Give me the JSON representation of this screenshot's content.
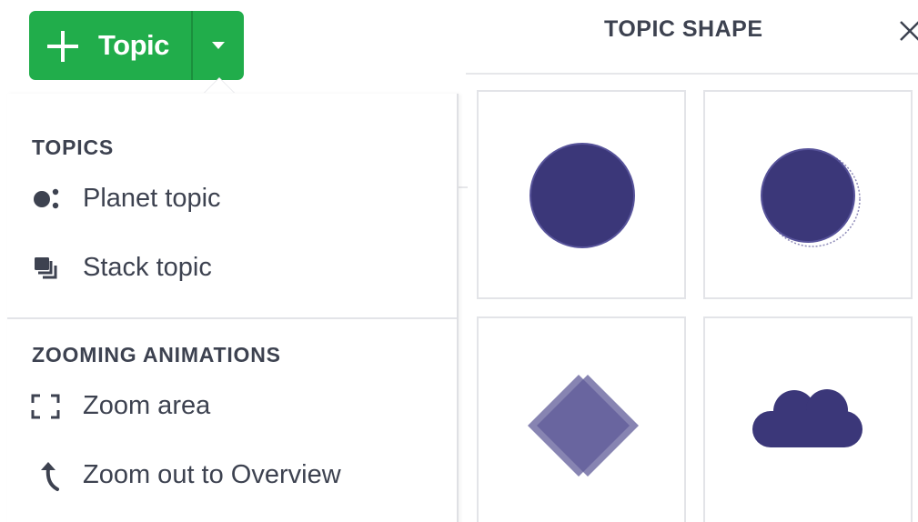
{
  "add_topic": {
    "label": "Topic",
    "button_color": "#21ad4b"
  },
  "shape_panel": {
    "title": "TOPIC SHAPE",
    "close_icon": "close-icon",
    "shapes": [
      {
        "name": "circle",
        "selected": false
      },
      {
        "name": "planet-circle",
        "selected": false
      },
      {
        "name": "diamond",
        "selected": false
      },
      {
        "name": "cloud",
        "selected": false
      }
    ],
    "shape_color": "#3b3779"
  },
  "dropdown": {
    "sections": [
      {
        "heading": "TOPICS",
        "items": [
          {
            "label": "Planet topic",
            "icon": "planet-topic-icon"
          },
          {
            "label": "Stack topic",
            "icon": "stack-topic-icon"
          }
        ]
      },
      {
        "heading": "ZOOMING ANIMATIONS",
        "items": [
          {
            "label": "Zoom area",
            "icon": "zoom-area-icon"
          },
          {
            "label": "Zoom out to Overview",
            "icon": "zoom-out-arrow-icon"
          }
        ]
      }
    ]
  }
}
